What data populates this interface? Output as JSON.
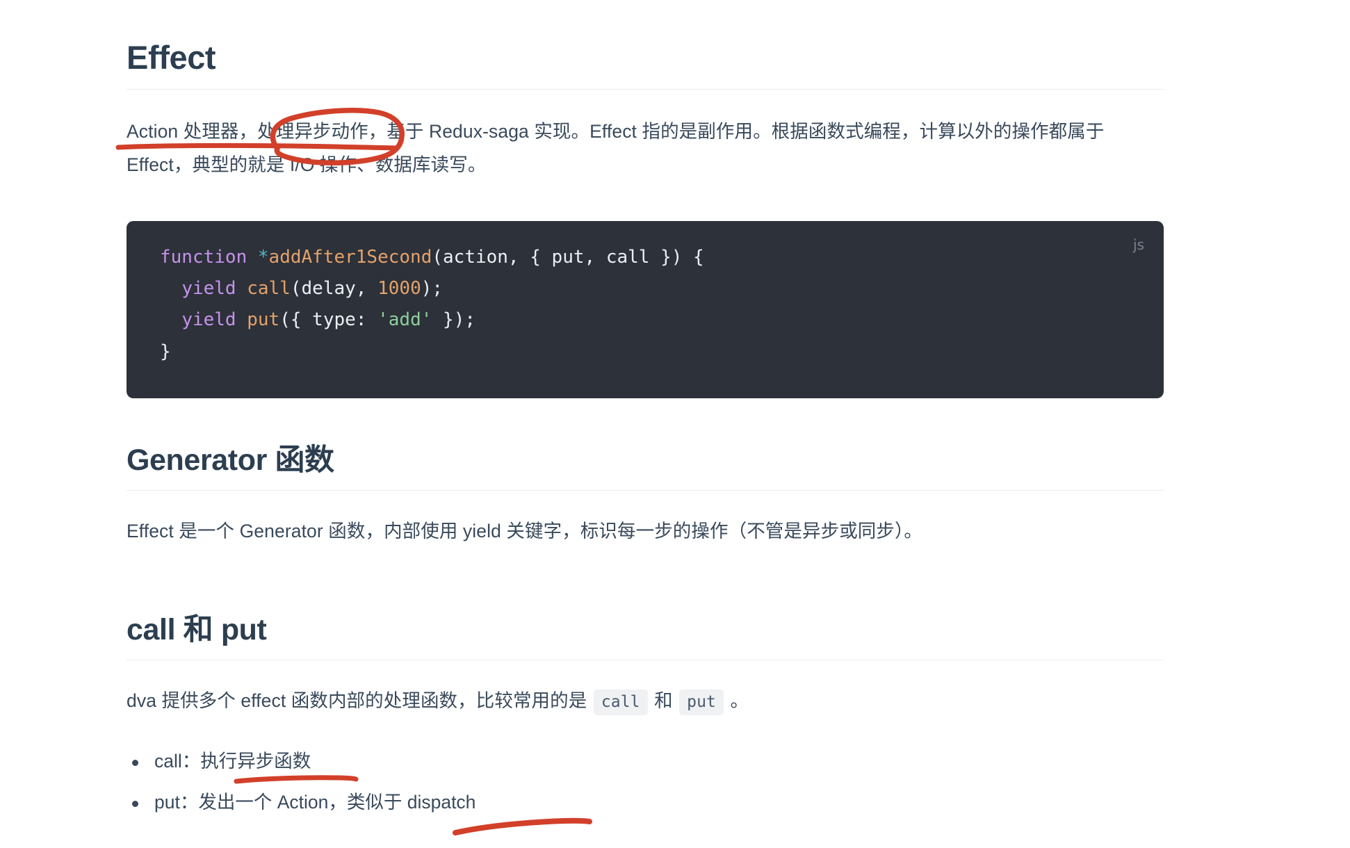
{
  "document": {
    "sections": [
      {
        "id": "effect",
        "heading": "Effect",
        "paragraph": "Action 处理器，处理异步动作，基于 Redux-saga 实现。Effect 指的是副作用。根据函数式编程，计算以外的操作都属于 Effect，典型的就是 I/O 操作、数据库读写。"
      },
      {
        "id": "generator",
        "heading": "Generator 函数",
        "paragraph": "Effect 是一个 Generator 函数，内部使用 yield 关键字，标识每一步的操作（不管是异步或同步）。"
      },
      {
        "id": "call-put",
        "heading": "call 和 put",
        "paragraph_prefix": "dva 提供多个 effect 函数内部的处理函数，比较常用的是 ",
        "chip_1": "call",
        "paragraph_mid": " 和 ",
        "chip_2": "put",
        "paragraph_suffix": " 。"
      }
    ]
  },
  "code_block": {
    "language_label": "js",
    "lines": [
      {
        "tokens": [
          {
            "t": "function",
            "c": "kw"
          },
          {
            "t": " ",
            "c": "pl"
          },
          {
            "t": "*",
            "c": "star"
          },
          {
            "t": "addAfter1Second",
            "c": "fn"
          },
          {
            "t": "(action, { put, call }) {",
            "c": "pl"
          }
        ]
      },
      {
        "tokens": [
          {
            "t": "  ",
            "c": "pl"
          },
          {
            "t": "yield",
            "c": "kw"
          },
          {
            "t": " ",
            "c": "pl"
          },
          {
            "t": "call",
            "c": "fn"
          },
          {
            "t": "(delay, ",
            "c": "pl"
          },
          {
            "t": "1000",
            "c": "num"
          },
          {
            "t": ");",
            "c": "pl"
          }
        ]
      },
      {
        "tokens": [
          {
            "t": "  ",
            "c": "pl"
          },
          {
            "t": "yield",
            "c": "kw"
          },
          {
            "t": " ",
            "c": "pl"
          },
          {
            "t": "put",
            "c": "fn"
          },
          {
            "t": "({ type: ",
            "c": "pl"
          },
          {
            "t": "'add'",
            "c": "str"
          },
          {
            "t": " });",
            "c": "pl"
          }
        ]
      },
      {
        "tokens": [
          {
            "t": "}",
            "c": "pl"
          }
        ]
      }
    ],
    "plain_text": "function *addAfter1Second(action, { put, call }) {\n  yield call(delay, 1000);\n  yield put({ type: 'add' });\n}"
  },
  "bullet_list": {
    "items": [
      "call：执行异步函数",
      "put：发出一个 Action，类似于 dispatch"
    ]
  },
  "annotations": {
    "color": "#d2402a",
    "marks": [
      {
        "name": "underline-action-handler",
        "kind": "underline",
        "over": "Action 处理器，"
      },
      {
        "name": "ellipse-async-action",
        "kind": "ellipse",
        "over": "处理异步动作"
      },
      {
        "name": "underline-async-function",
        "kind": "underline",
        "over": "执行异步函数"
      },
      {
        "name": "underline-dispatch",
        "kind": "underline",
        "over": "dispatch"
      }
    ]
  },
  "colors": {
    "heading": "#2c3e50",
    "body_text": "#39495b",
    "rule": "#ebedef",
    "code_bg": "#2c313a",
    "chip_bg": "#eff1f3",
    "annotation_red": "#d2402a"
  }
}
